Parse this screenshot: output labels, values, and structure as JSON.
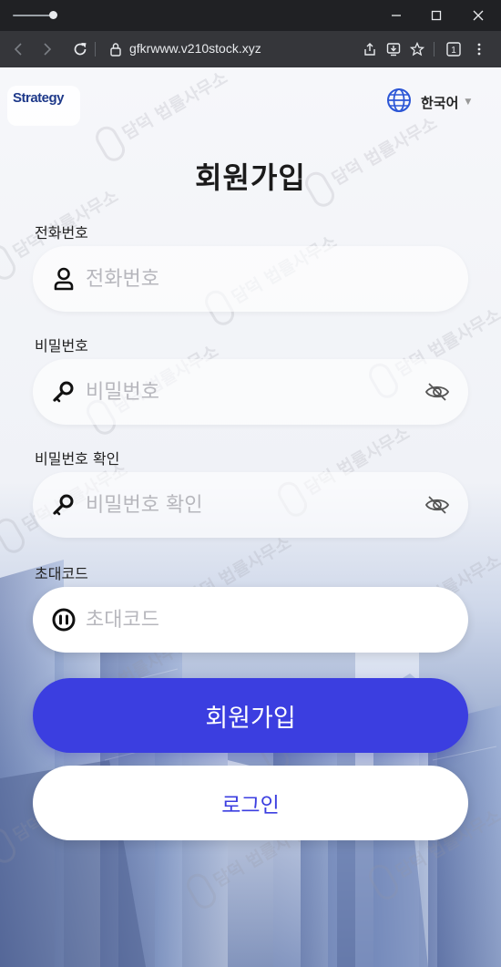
{
  "browser": {
    "url": "gfkrwww.v210stock.xyz",
    "ext_badge": "1"
  },
  "header": {
    "logo_text": "Strategy",
    "language_label": "한국어"
  },
  "form": {
    "title": "회원가입",
    "phone": {
      "label": "전화번호",
      "placeholder": "전화번호",
      "value": ""
    },
    "password": {
      "label": "비밀번호",
      "placeholder": "비밀번호",
      "value": ""
    },
    "password_confirm": {
      "label": "비밀번호 확인",
      "placeholder": "비밀번호 확인",
      "value": ""
    },
    "invite_code": {
      "label": "초대코드",
      "placeholder": "초대코드",
      "value": ""
    },
    "submit_label": "회원가입",
    "login_label": "로그인"
  },
  "watermark": {
    "text": "담덕 법률사무소"
  },
  "colors": {
    "primary": "#3b3ee0",
    "chrome_bg": "#202124",
    "toolbar_bg": "#35363a",
    "page_bg": "#f4f5f8"
  }
}
